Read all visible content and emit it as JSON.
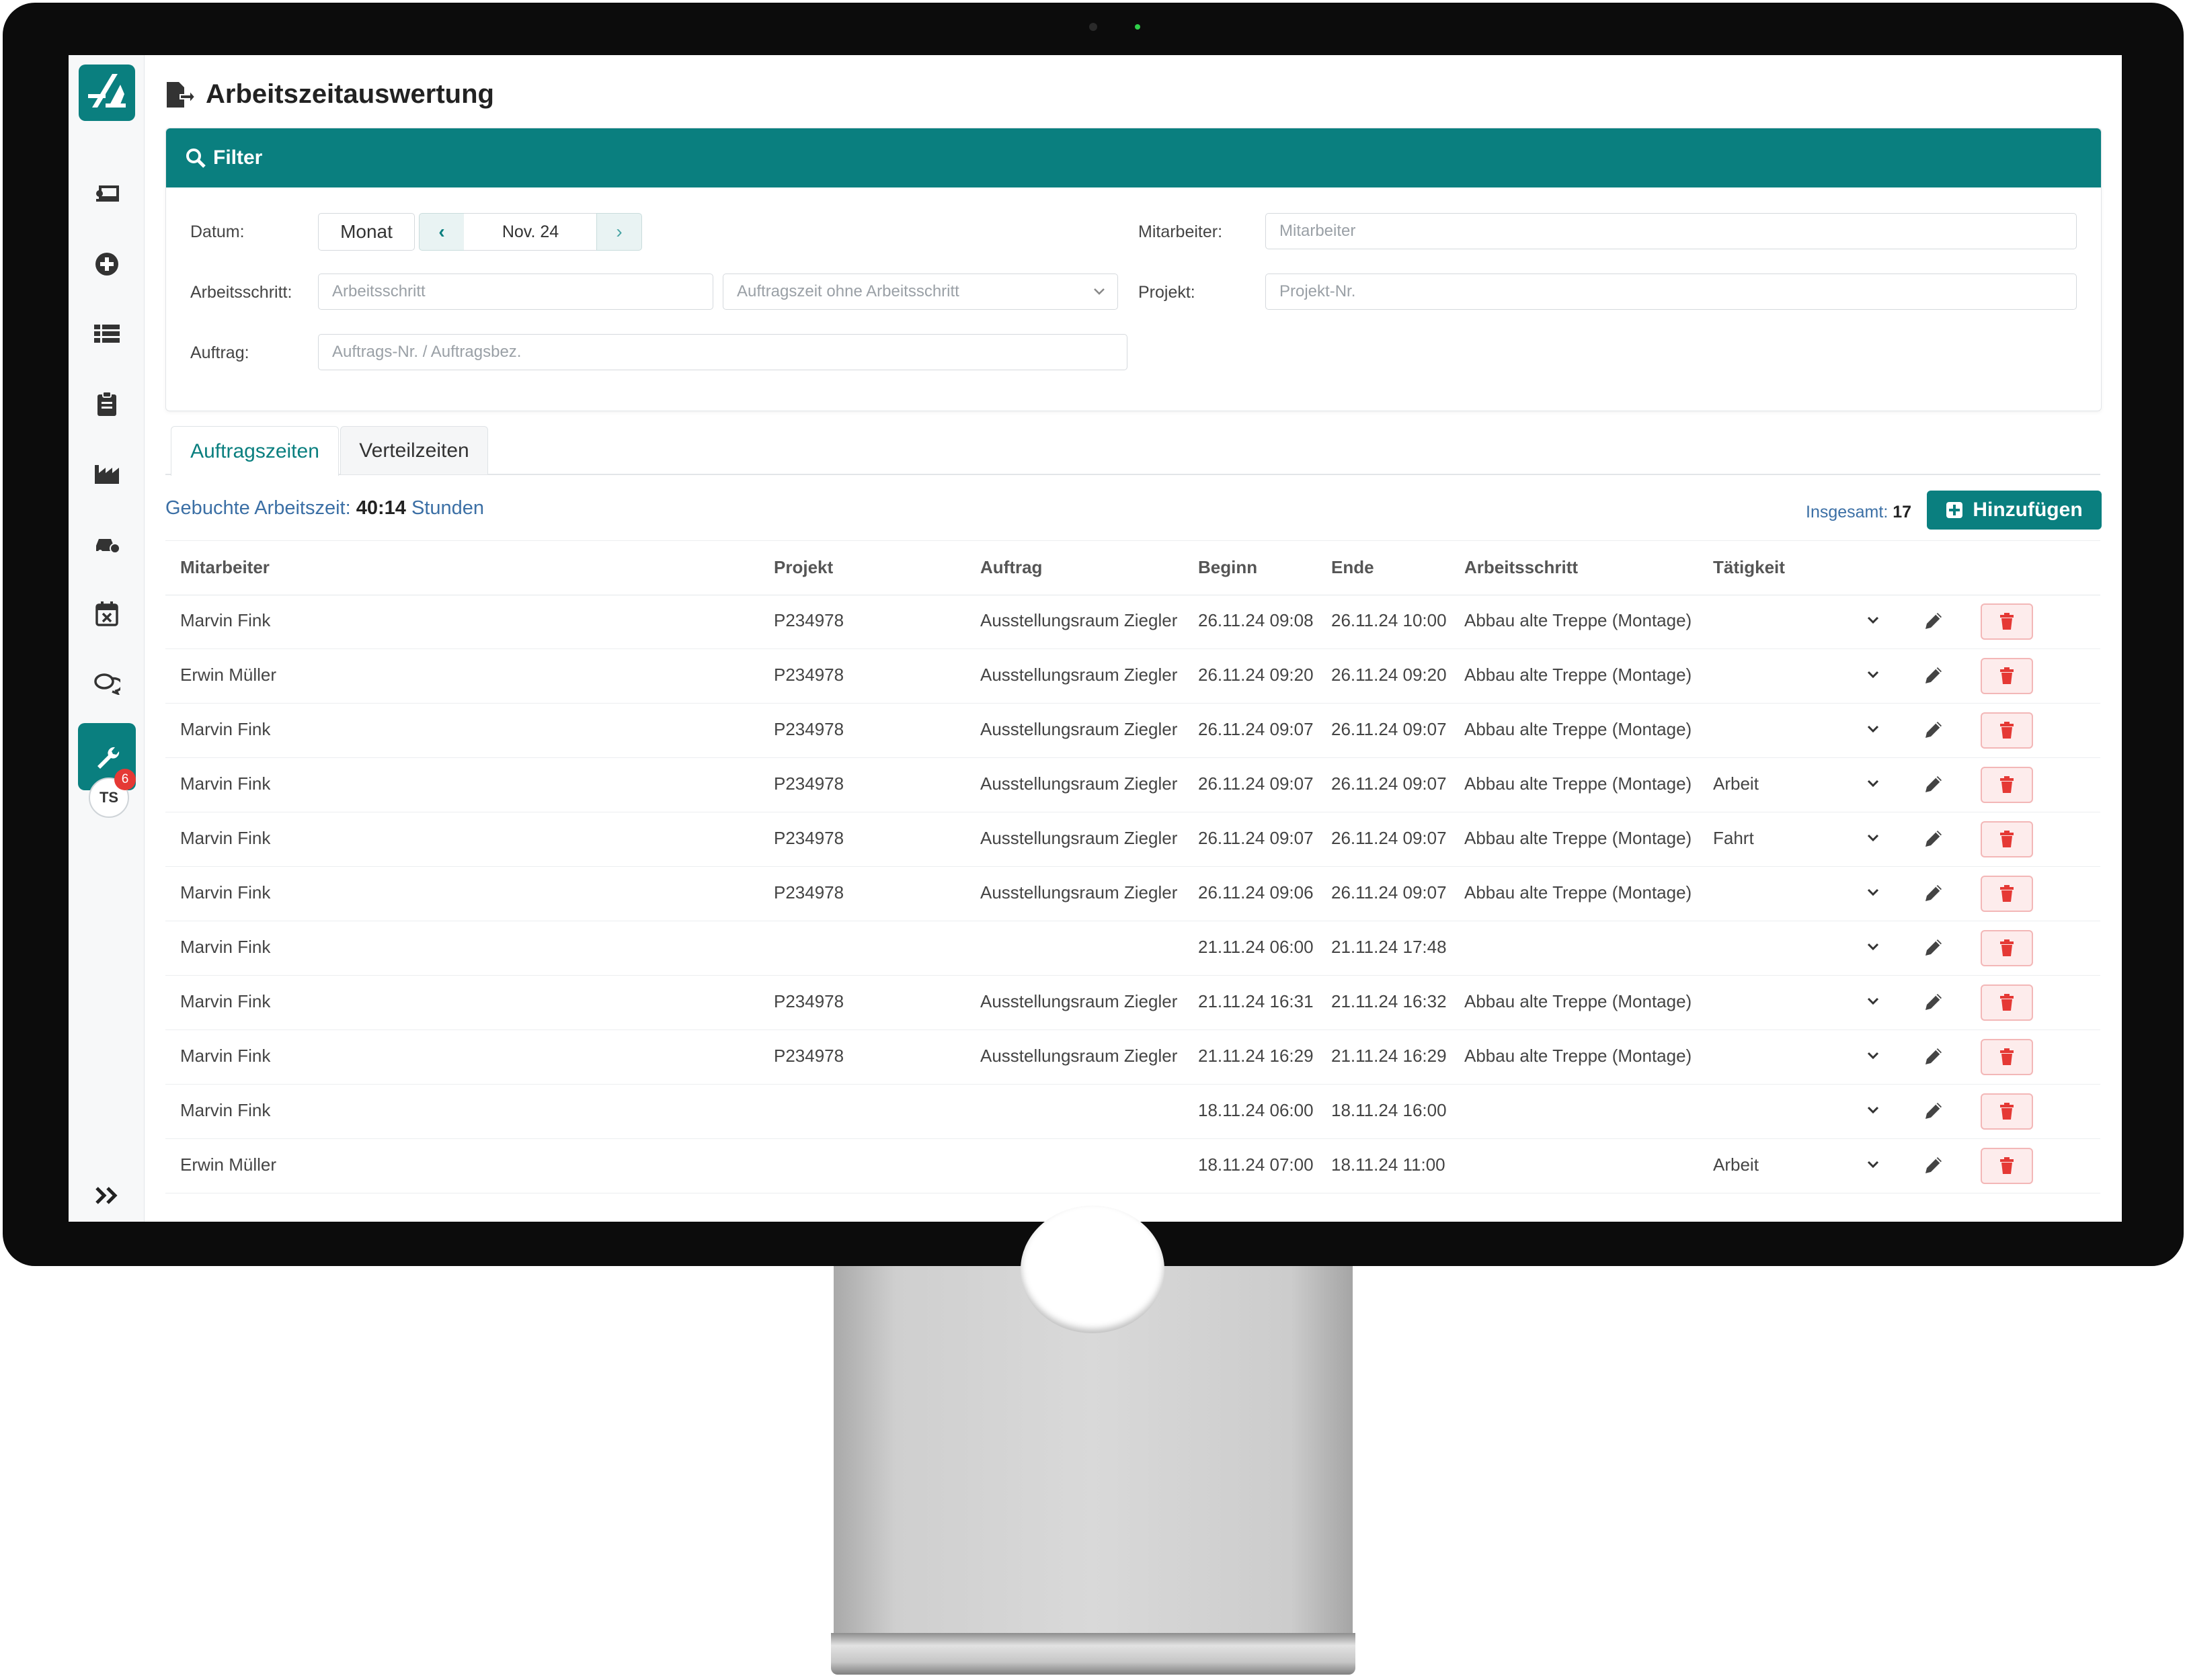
{
  "app": {
    "page_title": "Arbeitszeitauswertung",
    "user_initials": "TS",
    "notification_count": "6",
    "accent_color": "#0a7f7f"
  },
  "sidebar": {
    "items": [
      {
        "name": "timetracking",
        "icon": "laptop-user-icon"
      },
      {
        "name": "add",
        "icon": "plus-circle-icon"
      },
      {
        "name": "list",
        "icon": "list-icon"
      },
      {
        "name": "clipboard",
        "icon": "clipboard-icon"
      },
      {
        "name": "factory",
        "icon": "factory-icon"
      },
      {
        "name": "vehicle",
        "icon": "car-icon"
      },
      {
        "name": "calendar",
        "icon": "calendar-x-icon"
      },
      {
        "name": "chat",
        "icon": "chat-icon"
      },
      {
        "name": "tools",
        "icon": "wrench-icon",
        "active": true
      }
    ],
    "expand_icon": "double-chevron-right-icon"
  },
  "filter": {
    "header": "Filter",
    "datum_label": "Datum:",
    "period_button": "Monat",
    "period_value": "Nov. 24",
    "mitarbeiter_label": "Mitarbeiter:",
    "mitarbeiter_placeholder": "Mitarbeiter",
    "arbeitsschritt_label": "Arbeitsschritt:",
    "arbeitsschritt_placeholder": "Arbeitsschritt",
    "arbeitsschritt_select": "Auftragszeit ohne Arbeitsschritt",
    "projekt_label": "Projekt:",
    "projekt_placeholder": "Projekt-Nr.",
    "auftrag_label": "Auftrag:",
    "auftrag_placeholder": "Auftrags-Nr. / Auftragsbez."
  },
  "tabs": [
    "Auftragszeiten",
    "Verteilzeiten"
  ],
  "summary": {
    "label": "Gebuchte Arbeitszeit:",
    "value": "40:14",
    "unit": "Stunden",
    "total_label": "Insgesamt:",
    "total_value": "17",
    "add_button": "Hinzufügen"
  },
  "table": {
    "columns": [
      "Mitarbeiter",
      "Projekt",
      "Auftrag",
      "Beginn",
      "Ende",
      "Arbeitsschritt",
      "Tätigkeit"
    ],
    "rows": [
      [
        "Marvin Fink",
        "P234978",
        "Ausstellungsraum Ziegler",
        "26.11.24 09:08",
        "26.11.24 10:00",
        "Abbau alte Treppe (Montage)",
        ""
      ],
      [
        "Erwin Müller",
        "P234978",
        "Ausstellungsraum Ziegler",
        "26.11.24 09:20",
        "26.11.24 09:20",
        "Abbau alte Treppe (Montage)",
        ""
      ],
      [
        "Marvin Fink",
        "P234978",
        "Ausstellungsraum Ziegler",
        "26.11.24 09:07",
        "26.11.24 09:07",
        "Abbau alte Treppe (Montage)",
        ""
      ],
      [
        "Marvin Fink",
        "P234978",
        "Ausstellungsraum Ziegler",
        "26.11.24 09:07",
        "26.11.24 09:07",
        "Abbau alte Treppe (Montage)",
        "Arbeit"
      ],
      [
        "Marvin Fink",
        "P234978",
        "Ausstellungsraum Ziegler",
        "26.11.24 09:07",
        "26.11.24 09:07",
        "Abbau alte Treppe (Montage)",
        "Fahrt"
      ],
      [
        "Marvin Fink",
        "P234978",
        "Ausstellungsraum Ziegler",
        "26.11.24 09:06",
        "26.11.24 09:07",
        "Abbau alte Treppe (Montage)",
        ""
      ],
      [
        "Marvin Fink",
        "",
        "",
        "21.11.24 06:00",
        "21.11.24 17:48",
        "",
        ""
      ],
      [
        "Marvin Fink",
        "P234978",
        "Ausstellungsraum Ziegler",
        "21.11.24 16:31",
        "21.11.24 16:32",
        "Abbau alte Treppe (Montage)",
        ""
      ],
      [
        "Marvin Fink",
        "P234978",
        "Ausstellungsraum Ziegler",
        "21.11.24 16:29",
        "21.11.24 16:29",
        "Abbau alte Treppe (Montage)",
        ""
      ],
      [
        "Marvin Fink",
        "",
        "",
        "18.11.24 06:00",
        "18.11.24 16:00",
        "",
        ""
      ],
      [
        "Erwin Müller",
        "",
        "",
        "18.11.24 07:00",
        "18.11.24 11:00",
        "",
        "Arbeit"
      ]
    ],
    "row_actions": [
      "chevron-down-icon",
      "pencil-icon",
      "trash-icon"
    ]
  }
}
